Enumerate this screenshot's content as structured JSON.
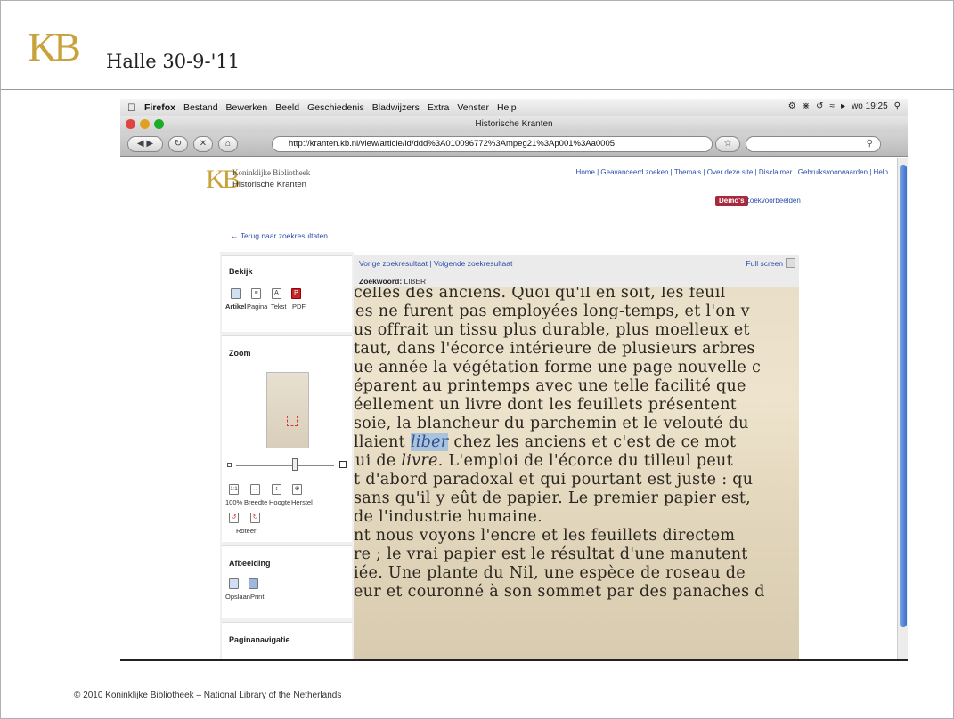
{
  "slide": {
    "logo": "KB",
    "title": "Halle 30-9-'11",
    "footer": "© 2010  Koninklijke Bibliotheek – National Library of the Netherlands"
  },
  "menubar": {
    "app": "Firefox",
    "items": [
      "Bestand",
      "Bewerken",
      "Beeld",
      "Geschiedenis",
      "Bladwijzers",
      "Extra",
      "Venster",
      "Help"
    ],
    "clock": "wo 19:25"
  },
  "window": {
    "title": "Historische Kranten",
    "url": "http://kranten.kb.nl/view/article/id/ddd%3A010096772%3Ampeg21%3Ap001%3Aa0005"
  },
  "site": {
    "logo": "KB",
    "name_line1": "Koninklijke Bibliotheek",
    "name_line2": "Historische Kranten",
    "topnav": "Home | Geavanceerd zoeken | Thema's | Over deze site | Disclaimer | Gebruiksvoorwaarden | Help",
    "demo_badge": "Demo's",
    "demo_link": "Zoekvoorbeelden",
    "back_link": "← Terug naar zoekresultaten"
  },
  "sidebar": {
    "bekijk": {
      "title": "Bekijk",
      "items": [
        "Artikel",
        "Pagina",
        "Tekst",
        "PDF"
      ]
    },
    "zoom": {
      "title": "Zoom",
      "buttons": [
        "100%",
        "Breedte",
        "Hoogte",
        "Herstel"
      ],
      "rotate": "Roteer",
      "slider_level": 0.6
    },
    "afbeelding": {
      "title": "Afbeelding",
      "items": [
        "Opslaan",
        "Print"
      ]
    },
    "paginanavigatie": {
      "title": "Paginanavigatie"
    }
  },
  "viewer": {
    "nav": "Vorige zoekresultaat | Volgende zoekresultaat",
    "fullscreen": "Full screen",
    "keyword_label": "Zoekwoord:",
    "keyword_value": "LIBER",
    "highlight": "liber"
  },
  "scan_text": [
    "celles des anciens. Quoi qu'il en soit, les feuil",
    "es ne furent pas employées long-temps, et l'on v",
    "us offrait un tissu plus durable, plus moelleux et",
    "taut, dans l'écorce intérieure de plusieurs arbres",
    "ue année la végétation forme une page nouvelle c",
    "éparent au printemps avec une telle facilité que",
    "éellement un livre dont les feuillets présentent",
    "soie, la blancheur du parchemin et le velouté du",
    "llaient",
    " chez les anciens et c'est de ce mot",
    "ui de",
    "livre.",
    " L'emploi de l'écorce du tilleul peut",
    "t d'abord paradoxal et qui pourtant est juste : qu",
    "sans qu'il y eût de papier. Le premier papier est,",
    "de l'industrie humaine.",
    "nt nous voyons l'encre et les feuillets directem",
    "re ; le vrai papier est le résultat d'une manutent",
    "iée. Une plante du Nil, une espèce de roseau de",
    "eur et couronné à son sommet par des panaches d"
  ]
}
